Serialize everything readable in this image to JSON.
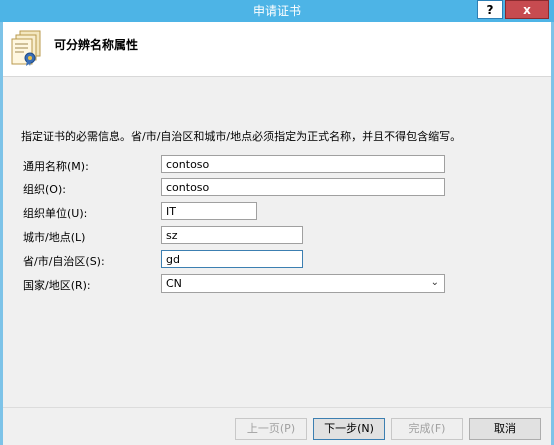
{
  "window": {
    "title": "申请证书",
    "help_glyph": "?",
    "close_glyph": "x"
  },
  "header": {
    "title": "可分辨名称属性",
    "icon": "certificate-icon"
  },
  "instruction": "指定证书的必需信息。省/市/自治区和城市/地点必须指定为正式名称，并且不得包含缩写。",
  "fields": {
    "common_name": {
      "label": "通用名称(M):",
      "value": "contoso"
    },
    "organization": {
      "label": "组织(O):",
      "value": "contoso"
    },
    "org_unit": {
      "label": "组织单位(U):",
      "value": "IT"
    },
    "city": {
      "label": "城市/地点(L)",
      "value": "sz"
    },
    "state": {
      "label": "省/市/自治区(S):",
      "value": "gd"
    },
    "country": {
      "label": "国家/地区(R):",
      "value": "CN"
    }
  },
  "buttons": {
    "prev": "上一页(P)",
    "next": "下一步(N)",
    "finish": "完成(F)",
    "cancel": "取消"
  },
  "colors": {
    "titlebar": "#4db4e6",
    "close": "#c74b50",
    "focus_border": "#3c7fb1"
  }
}
